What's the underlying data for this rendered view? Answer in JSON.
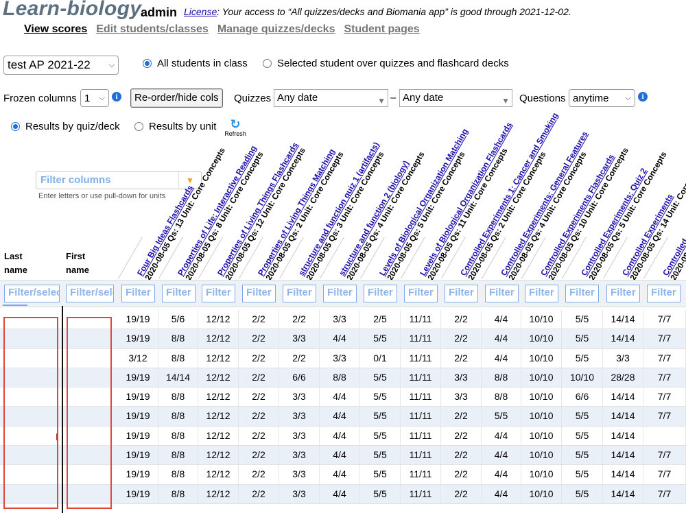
{
  "header": {
    "logo": "Learn-biology",
    "user": "admin",
    "license_link": "License",
    "license_text": ": Your access to “All quizzes/decks and Biomania app” is good through 2021-12-02."
  },
  "tabs": [
    {
      "label": "View scores",
      "active": true
    },
    {
      "label": "Edit students/classes",
      "active": false
    },
    {
      "label": "Manage quizzes/decks",
      "active": false
    },
    {
      "label": "Student pages",
      "active": false
    }
  ],
  "controls": {
    "class_select": "test AP 2021-22",
    "view_all": "All students in class",
    "view_selected": "Selected student over quizzes and flashcard decks",
    "frozen_label": "Frozen columns",
    "frozen_value": "1",
    "reorder_button": "Re-order/hide cols",
    "quizzes_label": "Quizzes",
    "date_from": "Any date",
    "date_dash": "–",
    "date_to": "Any date",
    "questions_label": "Questions",
    "questions_value": "anytime",
    "results_by_quiz": "Results by quiz/deck",
    "results_by_unit": "Results by unit",
    "refresh_label": "Refresh",
    "filter_columns_placeholder": "Filter columns",
    "filter_columns_hint": "Enter letters or use pull-down for units"
  },
  "icons": {
    "info": "info-icon",
    "refresh": "refresh-icon",
    "chevron": "chevron-down-icon"
  },
  "colors": {
    "link": "#1a0dab",
    "accent": "#1f6fd6",
    "row_alt": "#eaf0f7",
    "redact_border": "#e0473a"
  },
  "table": {
    "last_name_header": "Last name",
    "first_name_header": "First name",
    "name_filter_placeholder_last": "Filter/select",
    "name_filter_placeholder_first": "Filter/select",
    "col_filter_placeholder": "Filter",
    "columns": [
      {
        "title": "Four Big Ideas Flashcards",
        "date": "2020-08-05",
        "qs": "13",
        "unit": "Core Concepts"
      },
      {
        "title": "Properties of Life: Interactive Reading",
        "date": "2020-08-05",
        "qs": "8",
        "unit": "Core Concepts"
      },
      {
        "title": "Properties of Living Things Flashcards",
        "date": "2020-08-05",
        "qs": "12",
        "unit": "Core Concepts"
      },
      {
        "title": "Properties of Living Things Matching",
        "date": "2020-08-05",
        "qs": "2",
        "unit": "Core Concepts"
      },
      {
        "title": "structure and function quiz 1 (artifacts)",
        "date": "2020-08-05",
        "qs": "3",
        "unit": "Core Concepts"
      },
      {
        "title": "structure and function 2 (biology)",
        "date": "2020-08-05",
        "qs": "4",
        "unit": "Core Concepts"
      },
      {
        "title": "Levels of Biological Organization Matching",
        "date": "2020-08-05",
        "qs": "5",
        "unit": "Core Concepts"
      },
      {
        "title": "Levels of Biological Organization Flashcards",
        "date": "2020-08-05",
        "qs": "11",
        "unit": "Core Concepts"
      },
      {
        "title": "Controlled Experiments 1: Cancer and Smoking",
        "date": "2020-08-05",
        "qs": "2",
        "unit": "Core Concepts"
      },
      {
        "title": "Controlled Experiments: General Features",
        "date": "2020-08-05",
        "qs": "4",
        "unit": "Core Concepts"
      },
      {
        "title": "Controlled Experiments Flashcards",
        "date": "2020-08-05",
        "qs": "10",
        "unit": "Core Concepts"
      },
      {
        "title": "Controlled Experiments: Quiz 2",
        "date": "2020-08-05",
        "qs": "5",
        "unit": "Core Concepts"
      },
      {
        "title": "Controlled Experiments",
        "date": "2020-08-05",
        "qs": "14",
        "unit": "Core Concepts"
      },
      {
        "title": "Controlled",
        "date": "2020-08-05",
        "qs": "",
        "unit": ""
      }
    ],
    "meta_labels": {
      "qs": "Qs:",
      "unit": "Unit:"
    },
    "rows": [
      [
        "19/19",
        "5/6",
        "12/12",
        "2/2",
        "2/2",
        "3/3",
        "2/5",
        "11/11",
        "2/2",
        "4/4",
        "10/10",
        "5/5",
        "14/14",
        "7/7"
      ],
      [
        "19/19",
        "8/8",
        "12/12",
        "2/2",
        "3/3",
        "4/4",
        "5/5",
        "11/11",
        "2/2",
        "4/4",
        "10/10",
        "5/5",
        "14/14",
        "7/7"
      ],
      [
        "3/12",
        "8/8",
        "12/12",
        "2/2",
        "2/2",
        "3/3",
        "0/1",
        "11/11",
        "2/2",
        "4/4",
        "10/10",
        "5/5",
        "3/3",
        "7/7"
      ],
      [
        "19/19",
        "14/14",
        "12/12",
        "2/2",
        "6/6",
        "8/8",
        "5/5",
        "11/11",
        "3/3",
        "8/8",
        "10/10",
        "10/10",
        "28/28",
        "7/7"
      ],
      [
        "19/19",
        "8/8",
        "12/12",
        "2/2",
        "3/3",
        "4/4",
        "5/5",
        "11/11",
        "3/3",
        "8/8",
        "10/10",
        "6/6",
        "14/14",
        "7/7"
      ],
      [
        "19/19",
        "8/8",
        "12/12",
        "2/2",
        "3/3",
        "4/4",
        "5/5",
        "11/11",
        "2/2",
        "5/5",
        "10/10",
        "5/5",
        "14/14",
        "7/7"
      ],
      [
        "19/19",
        "8/8",
        "12/12",
        "2/2",
        "3/3",
        "4/4",
        "5/5",
        "11/11",
        "2/2",
        "4/4",
        "10/10",
        "5/5",
        "14/14",
        ""
      ],
      [
        "19/19",
        "8/8",
        "12/12",
        "2/2",
        "3/3",
        "4/4",
        "5/5",
        "11/11",
        "2/2",
        "4/4",
        "10/10",
        "5/5",
        "14/14",
        "7/7"
      ],
      [
        "19/19",
        "8/8",
        "12/12",
        "2/2",
        "3/3",
        "4/4",
        "5/5",
        "11/11",
        "2/2",
        "4/4",
        "10/10",
        "5/5",
        "14/14",
        "7/7"
      ],
      [
        "19/19",
        "8/8",
        "12/12",
        "2/2",
        "3/3",
        "4/4",
        "5/5",
        "11/11",
        "2/2",
        "4/4",
        "10/10",
        "5/5",
        "14/14",
        "7/7"
      ]
    ]
  }
}
